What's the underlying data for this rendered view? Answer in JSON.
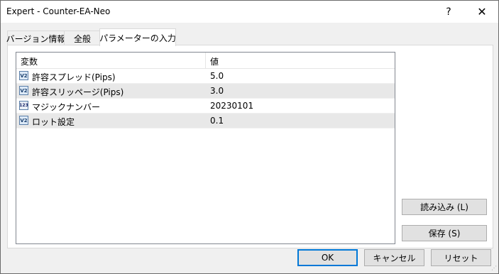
{
  "window": {
    "title": "Expert - Counter-EA-Neo"
  },
  "titlebar": {
    "help_glyph": "?",
    "close_glyph": "✕"
  },
  "tabs": [
    {
      "label": "バージョン情報"
    },
    {
      "label": "全般"
    },
    {
      "label": "パラメーターの入力",
      "active": true
    }
  ],
  "grid": {
    "columns": {
      "name": "変数",
      "value": "値"
    },
    "rows": [
      {
        "icon": "double-value-icon",
        "icon_text": "V2",
        "name": "許容スプレッド(Pips)",
        "value": "5.0"
      },
      {
        "icon": "double-value-icon",
        "icon_text": "V2",
        "name": "許容スリッページ(Pips)",
        "value": "3.0"
      },
      {
        "icon": "integer-value-icon",
        "icon_text": "123",
        "name": "マジックナンバー",
        "value": "20230101"
      },
      {
        "icon": "double-value-icon",
        "icon_text": "V2",
        "name": "ロット設定",
        "value": "0.1"
      }
    ]
  },
  "side_buttons": {
    "load": "読み込み (L)",
    "save": "保存 (S)"
  },
  "footer": {
    "ok": "OK",
    "cancel": "キャンセル",
    "reset": "リセット"
  },
  "colors": {
    "accent": "#0078d7",
    "row_alt": "#e8e8e8"
  }
}
